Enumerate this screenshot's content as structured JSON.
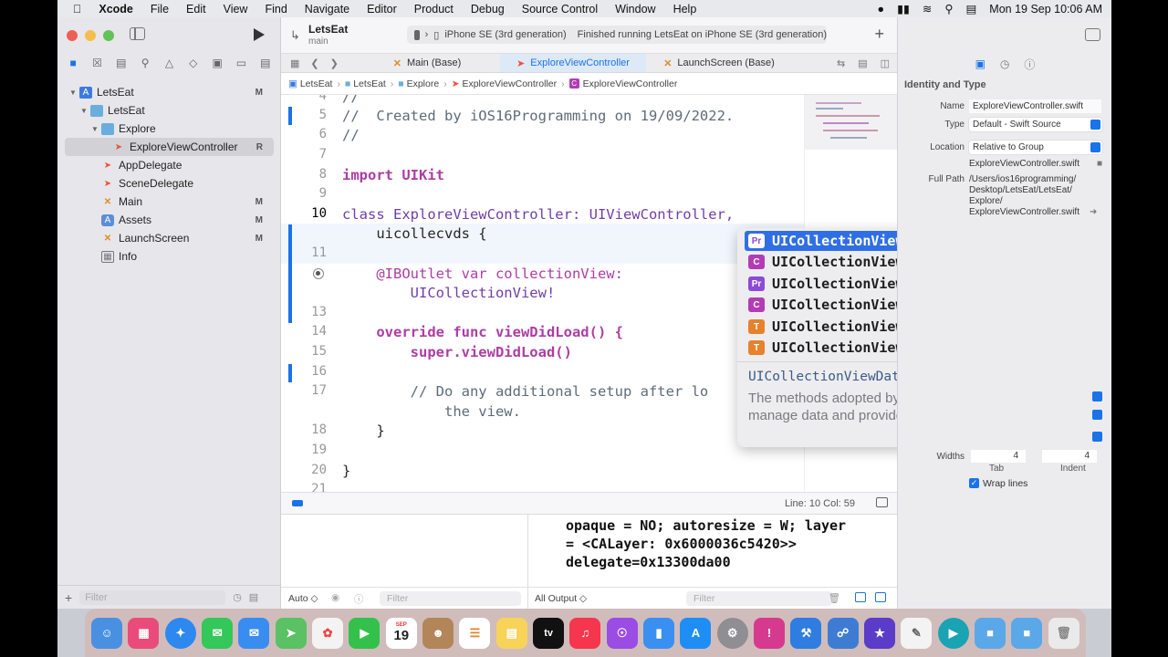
{
  "menubar": {
    "app": "Xcode",
    "items": [
      "File",
      "Edit",
      "View",
      "Find",
      "Navigate",
      "Editor",
      "Product",
      "Debug",
      "Source Control",
      "Window",
      "Help"
    ],
    "datetime": "Mon 19 Sep  10:06 AM"
  },
  "toolbar": {
    "project": "LetsEat",
    "branch": "main",
    "device": "iPhone SE (3rd generation)",
    "status": "Finished running LetsEat on iPhone SE (3rd generation)"
  },
  "navigator": {
    "items": [
      {
        "label": "LetsEat",
        "badge": "M"
      },
      {
        "label": "LetsEat",
        "badge": ""
      },
      {
        "label": "Explore",
        "badge": ""
      },
      {
        "label": "ExploreViewController",
        "badge": "R"
      },
      {
        "label": "AppDelegate",
        "badge": ""
      },
      {
        "label": "SceneDelegate",
        "badge": ""
      },
      {
        "label": "Main",
        "badge": "M"
      },
      {
        "label": "Assets",
        "badge": "M"
      },
      {
        "label": "LaunchScreen",
        "badge": "M"
      },
      {
        "label": "Info",
        "badge": ""
      }
    ],
    "filter_placeholder": "Filter"
  },
  "tabs": [
    {
      "label": "Main (Base)"
    },
    {
      "label": "ExploreViewController"
    },
    {
      "label": "LaunchScreen (Base)"
    }
  ],
  "jumpbar": [
    "LetsEat",
    "LetsEat",
    "Explore",
    "ExploreViewController",
    "ExploreViewController"
  ],
  "editor": {
    "lines": [
      {
        "num": "4",
        "text": "//"
      },
      {
        "num": "5",
        "text": "//  Created by iOS16Programming on 19/09/2022."
      },
      {
        "num": "6",
        "text": "//"
      },
      {
        "num": "7",
        "text": ""
      },
      {
        "num": "8",
        "text": "import UIKit"
      },
      {
        "num": "9",
        "text": ""
      },
      {
        "num": "10",
        "text": "class ExploreViewController: UIViewController,"
      },
      {
        "num": "",
        "text": "    uicollecvds {"
      },
      {
        "num": "11",
        "text": ""
      },
      {
        "num": "",
        "text": "    @IBOutlet var collectionView:"
      },
      {
        "num": "",
        "text": "        UICollectionView!"
      },
      {
        "num": "13",
        "text": ""
      },
      {
        "num": "14",
        "text": "    override func viewDidLoad() {"
      },
      {
        "num": "15",
        "text": "        super.viewDidLoad()"
      },
      {
        "num": "16",
        "text": ""
      },
      {
        "num": "17",
        "text": "        // Do any additional setup after lo"
      },
      {
        "num": "",
        "text": "            the view."
      },
      {
        "num": "18",
        "text": "    }"
      },
      {
        "num": "19",
        "text": ""
      },
      {
        "num": "20",
        "text": "}"
      },
      {
        "num": "21",
        "text": ""
      }
    ]
  },
  "completion": {
    "items": [
      {
        "kind": "Pr",
        "label": "UICollectionViewDataSource"
      },
      {
        "kind": "C",
        "label": "UICollectionViewDiffableDataSour…"
      },
      {
        "kind": "Pr",
        "label": "UICollectionViewDataSourcePrefet…"
      },
      {
        "kind": "C",
        "label": "UICollectionViewDiffableDataSour…"
      },
      {
        "kind": "T",
        "label": "UICollectionViewDiffableDataSour…"
      },
      {
        "kind": "T",
        "label": "UICollectionViewDiffableDataSour…"
      }
    ],
    "doc_title": "UICollectionViewDataSource",
    "doc_desc": "The methods adopted by the object you use to manage data and provide cells for a collection view."
  },
  "statusbar": {
    "position": "Line: 10  Col: 59"
  },
  "debug": {
    "console": [
      "opaque = NO; autoresize = W; layer",
      "= <CALayer: 0x6000036c5420>>",
      "delegate=0x13300da00"
    ],
    "auto_label": "Auto ◇",
    "output_label": "All Output ◇",
    "filter": "Filter"
  },
  "inspector": {
    "section": "Identity and Type",
    "name_label": "Name",
    "name_value": "ExploreViewController.swift",
    "type_label": "Type",
    "type_value": "Default - Swift Source",
    "location_label": "Location",
    "location_value": "Relative to Group",
    "location_file": "ExploreViewController.swift",
    "fullpath_label": "Full Path",
    "fullpath_value": [
      "/Users/ios16programming/",
      "Desktop/LetsEat/LetsEat/",
      "Explore/",
      "ExploreViewController.swift"
    ],
    "widths_label": "Widths",
    "tab_value": "4",
    "indent_value": "4",
    "tab_label": "Tab",
    "indent_label": "Indent",
    "wrap_label": "Wrap lines",
    "wrap_checked": true
  },
  "dock": {
    "calendar_day": "19",
    "calendar_month": "SEP",
    "tv_label": "tv"
  },
  "colors": {
    "accent": "#1a73e8",
    "swift": "#f05138",
    "keyword": "#ad3da4"
  }
}
